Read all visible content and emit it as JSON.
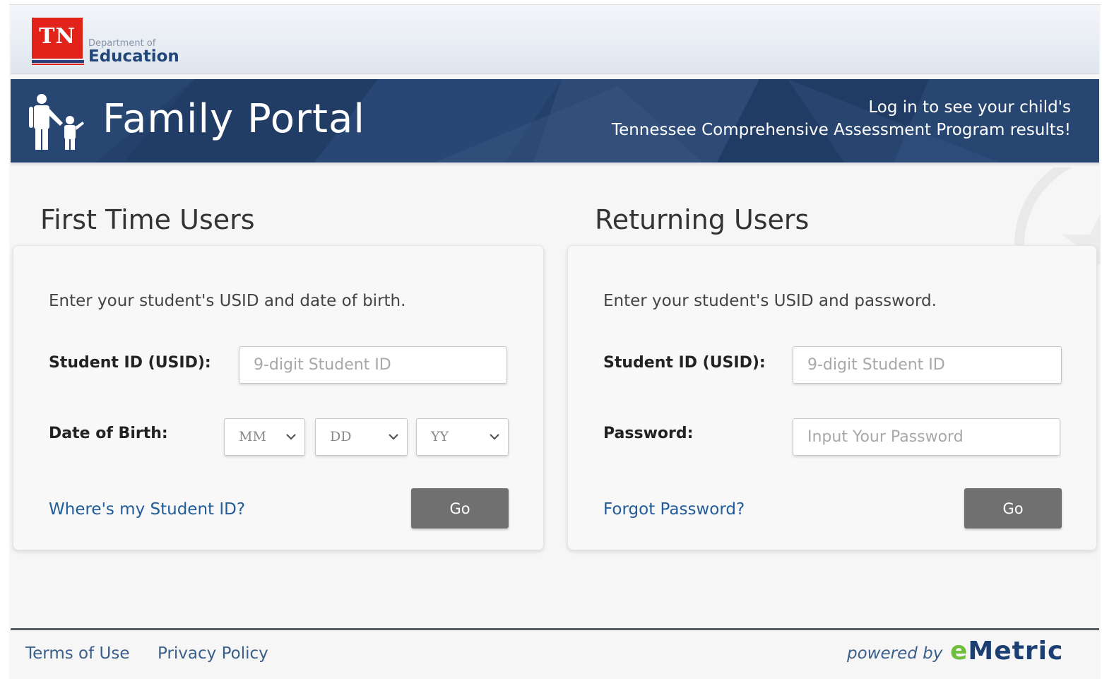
{
  "header": {
    "logo_text": "TN",
    "dept_small": "Department of",
    "dept_big": "Education"
  },
  "banner": {
    "title": "Family Portal",
    "tagline_line1": "Log in to see your child's",
    "tagline_line2": "Tennessee Comprehensive Assessment Program results!",
    "color": "#24416c"
  },
  "first_time": {
    "heading": "First Time Users",
    "intro": "Enter your student's USID and date of birth.",
    "student_id_label": "Student ID (USID):",
    "student_id_placeholder": "9-digit Student ID",
    "dob_label": "Date of Birth:",
    "month_value": "MM",
    "day_value": "DD",
    "year_value": "YY",
    "help_link": "Where's my Student ID?",
    "go_label": "Go"
  },
  "returning": {
    "heading": "Returning Users",
    "intro": "Enter your student's USID and password.",
    "student_id_label": "Student ID (USID):",
    "student_id_placeholder": "9-digit Student ID",
    "password_label": "Password:",
    "password_placeholder": "Input Your Password",
    "help_link": "Forgot Password?",
    "go_label": "Go"
  },
  "footer": {
    "terms": "Terms of Use",
    "privacy": "Privacy Policy",
    "powered_by": "powered by",
    "brand_e": "e",
    "brand_rest": "Metric"
  },
  "icons": {
    "family": "family-icon",
    "chevron": "chevron-down-icon",
    "seal": "state-seal-watermark"
  },
  "colors": {
    "logo_red": "#e2231a",
    "link_blue": "#1f5c99",
    "button_gray": "#707070",
    "emetric_green": "#6fbf3f"
  }
}
